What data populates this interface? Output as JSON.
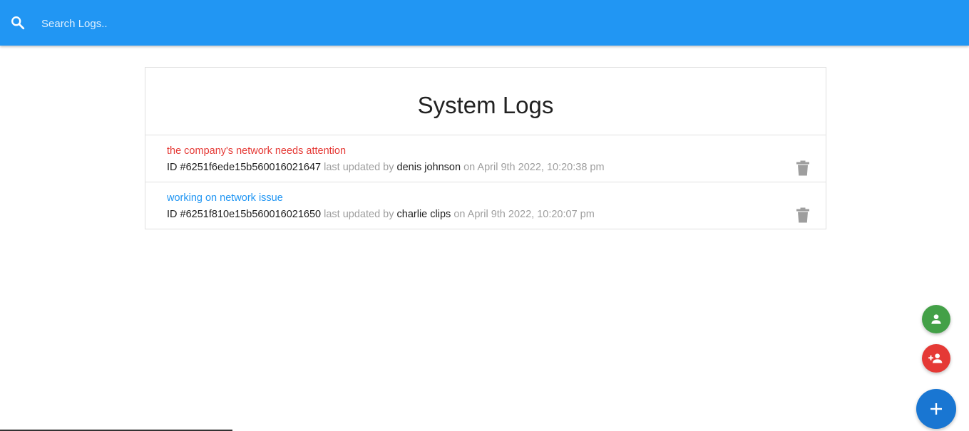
{
  "navbar": {
    "search_placeholder": "Search Logs..",
    "search_value": "",
    "background_color": "#2196f3"
  },
  "logs": {
    "title": "System Logs",
    "items": [
      {
        "message": "the company's network needs attention",
        "attention": true,
        "id_label": "ID",
        "id": "#6251f6ede15b560016021647",
        "updated_by_text": "last updated by",
        "tech": "denis johnson",
        "date_text": "on April 9th 2022, 10:20:38 pm"
      },
      {
        "message": "working on network issue",
        "attention": false,
        "id_label": "ID",
        "id": "#6251f810e15b560016021650",
        "updated_by_text": "last updated by",
        "tech": "charlie clips",
        "date_text": "on April 9th 2022, 10:20:07 pm"
      }
    ]
  },
  "fabs": {
    "users_color": "#43a047",
    "add_user_color": "#e53935",
    "add_log_color": "#1976d2",
    "icons": [
      "person-icon",
      "person-add-icon",
      "plus-icon"
    ]
  },
  "colors": {
    "attention": "#e53935",
    "normal": "#2196f3",
    "muted": "#9e9e9e"
  }
}
